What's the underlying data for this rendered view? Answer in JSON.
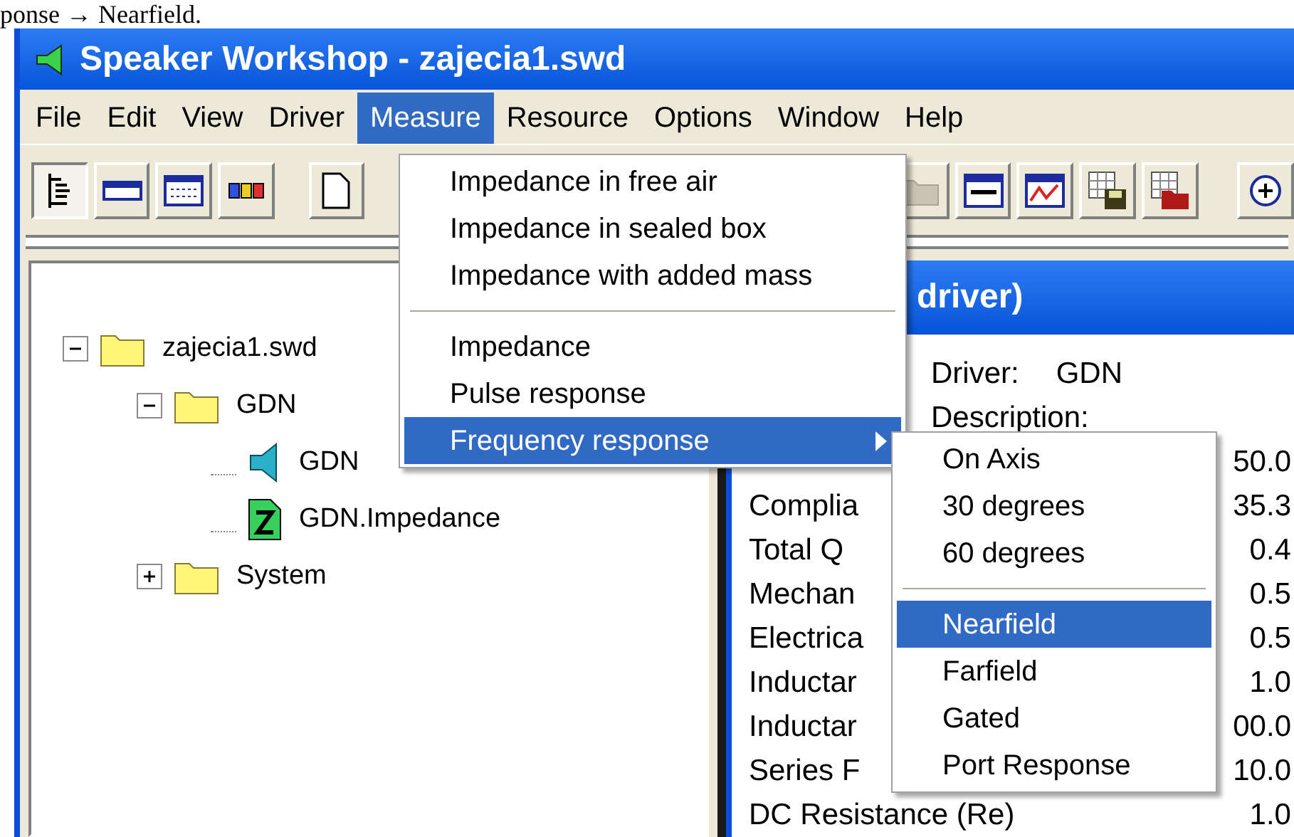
{
  "caption": "ponse → Nearfield.",
  "window": {
    "title": "Speaker Workshop - zajecia1.swd"
  },
  "menu_bar": [
    {
      "label": "File",
      "selected": false
    },
    {
      "label": "Edit",
      "selected": false
    },
    {
      "label": "View",
      "selected": false
    },
    {
      "label": "Driver",
      "selected": false
    },
    {
      "label": "Measure",
      "selected": true
    },
    {
      "label": "Resource",
      "selected": false
    },
    {
      "label": "Options",
      "selected": false
    },
    {
      "label": "Window",
      "selected": false
    },
    {
      "label": "Help",
      "selected": false
    }
  ],
  "tree": [
    {
      "label": "zajecia1.swd",
      "kind": "folder",
      "expanded": true,
      "children": [
        {
          "label": "GDN",
          "kind": "folder",
          "expanded": true,
          "children": [
            {
              "label": "GDN",
              "kind": "driver"
            },
            {
              "label": "GDN.Impedance",
              "kind": "impedance"
            }
          ]
        },
        {
          "label": "System",
          "kind": "folder",
          "expanded": false
        }
      ]
    }
  ],
  "driver_window": {
    "title": "driver)",
    "driver_label": "Driver:",
    "driver_value": "GDN",
    "description_label": "Description:",
    "rows": [
      {
        "value": "50.0"
      },
      {
        "label": "Complia",
        "value": "35.3"
      },
      {
        "label": "Total Q",
        "value": "0.4"
      },
      {
        "label": "Mechan",
        "value": "0.5"
      },
      {
        "label": "Electrica",
        "value": "0.5"
      },
      {
        "label": "Inductar",
        "value": "1.0"
      },
      {
        "label": "Inductar",
        "value": "00.0"
      },
      {
        "label": "Series F",
        "value": "10.0"
      },
      {
        "label": "DC Resistance (Re)",
        "value": "1.0"
      }
    ]
  },
  "measure_menu": [
    {
      "kind": "item",
      "label": "Impedance in free air",
      "selected": false
    },
    {
      "kind": "item",
      "label": "Impedance in sealed box",
      "selected": false
    },
    {
      "kind": "item",
      "label": "Impedance with added mass",
      "selected": false
    },
    {
      "kind": "separator"
    },
    {
      "kind": "item",
      "label": "Impedance",
      "selected": false
    },
    {
      "kind": "item",
      "label": "Pulse response",
      "selected": false
    },
    {
      "kind": "submenu",
      "label": "Frequency response",
      "selected": true
    }
  ],
  "frequency_submenu": [
    {
      "kind": "item",
      "label": "On Axis",
      "selected": false
    },
    {
      "kind": "item",
      "label": "30 degrees",
      "selected": false
    },
    {
      "kind": "item",
      "label": "60 degrees",
      "selected": false
    },
    {
      "kind": "separator"
    },
    {
      "kind": "item",
      "label": "Nearfield",
      "selected": true
    },
    {
      "kind": "item",
      "label": "Farfield",
      "selected": false
    },
    {
      "kind": "item",
      "label": "Gated",
      "selected": false
    },
    {
      "kind": "item",
      "label": "Port Response",
      "selected": false
    }
  ]
}
